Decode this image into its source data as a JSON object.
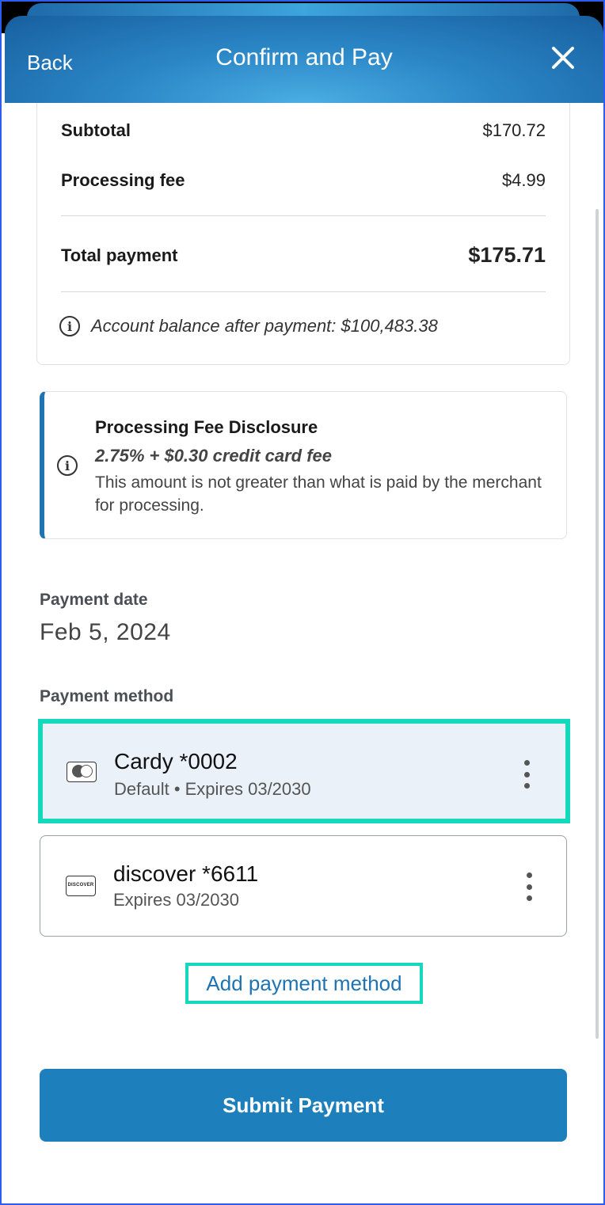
{
  "header": {
    "back_label": "Back",
    "title": "Confirm and Pay"
  },
  "summary": {
    "subtotal_label": "Subtotal",
    "subtotal_value": "$170.72",
    "fee_label": "Processing fee",
    "fee_value": "$4.99",
    "total_label": "Total payment",
    "total_value": "$175.71",
    "balance_text": "Account balance after payment: $100,483.38"
  },
  "disclosure": {
    "title": "Processing Fee Disclosure",
    "fee_rate": "2.75% + $0.30 credit card fee",
    "body": "This amount is not greater than what is paid by the merchant for processing."
  },
  "payment_date": {
    "label": "Payment date",
    "value": "Feb 5, 2024"
  },
  "payment_method": {
    "label": "Payment method",
    "methods": [
      {
        "name": "Cardy *0002",
        "detail": "Default • Expires 03/2030",
        "icon": "card-icon",
        "selected": true
      },
      {
        "name": "discover *6611",
        "detail": "Expires 03/2030",
        "icon": "discover-card-icon",
        "logo_text": "DISCOVER",
        "selected": false
      }
    ],
    "add_label": "Add payment method"
  },
  "submit_label": "Submit Payment",
  "colors": {
    "header": "#2b86c6",
    "accent": "#1e73b3",
    "highlight": "#15d9bc",
    "selected_bg": "#eaf1f8"
  }
}
